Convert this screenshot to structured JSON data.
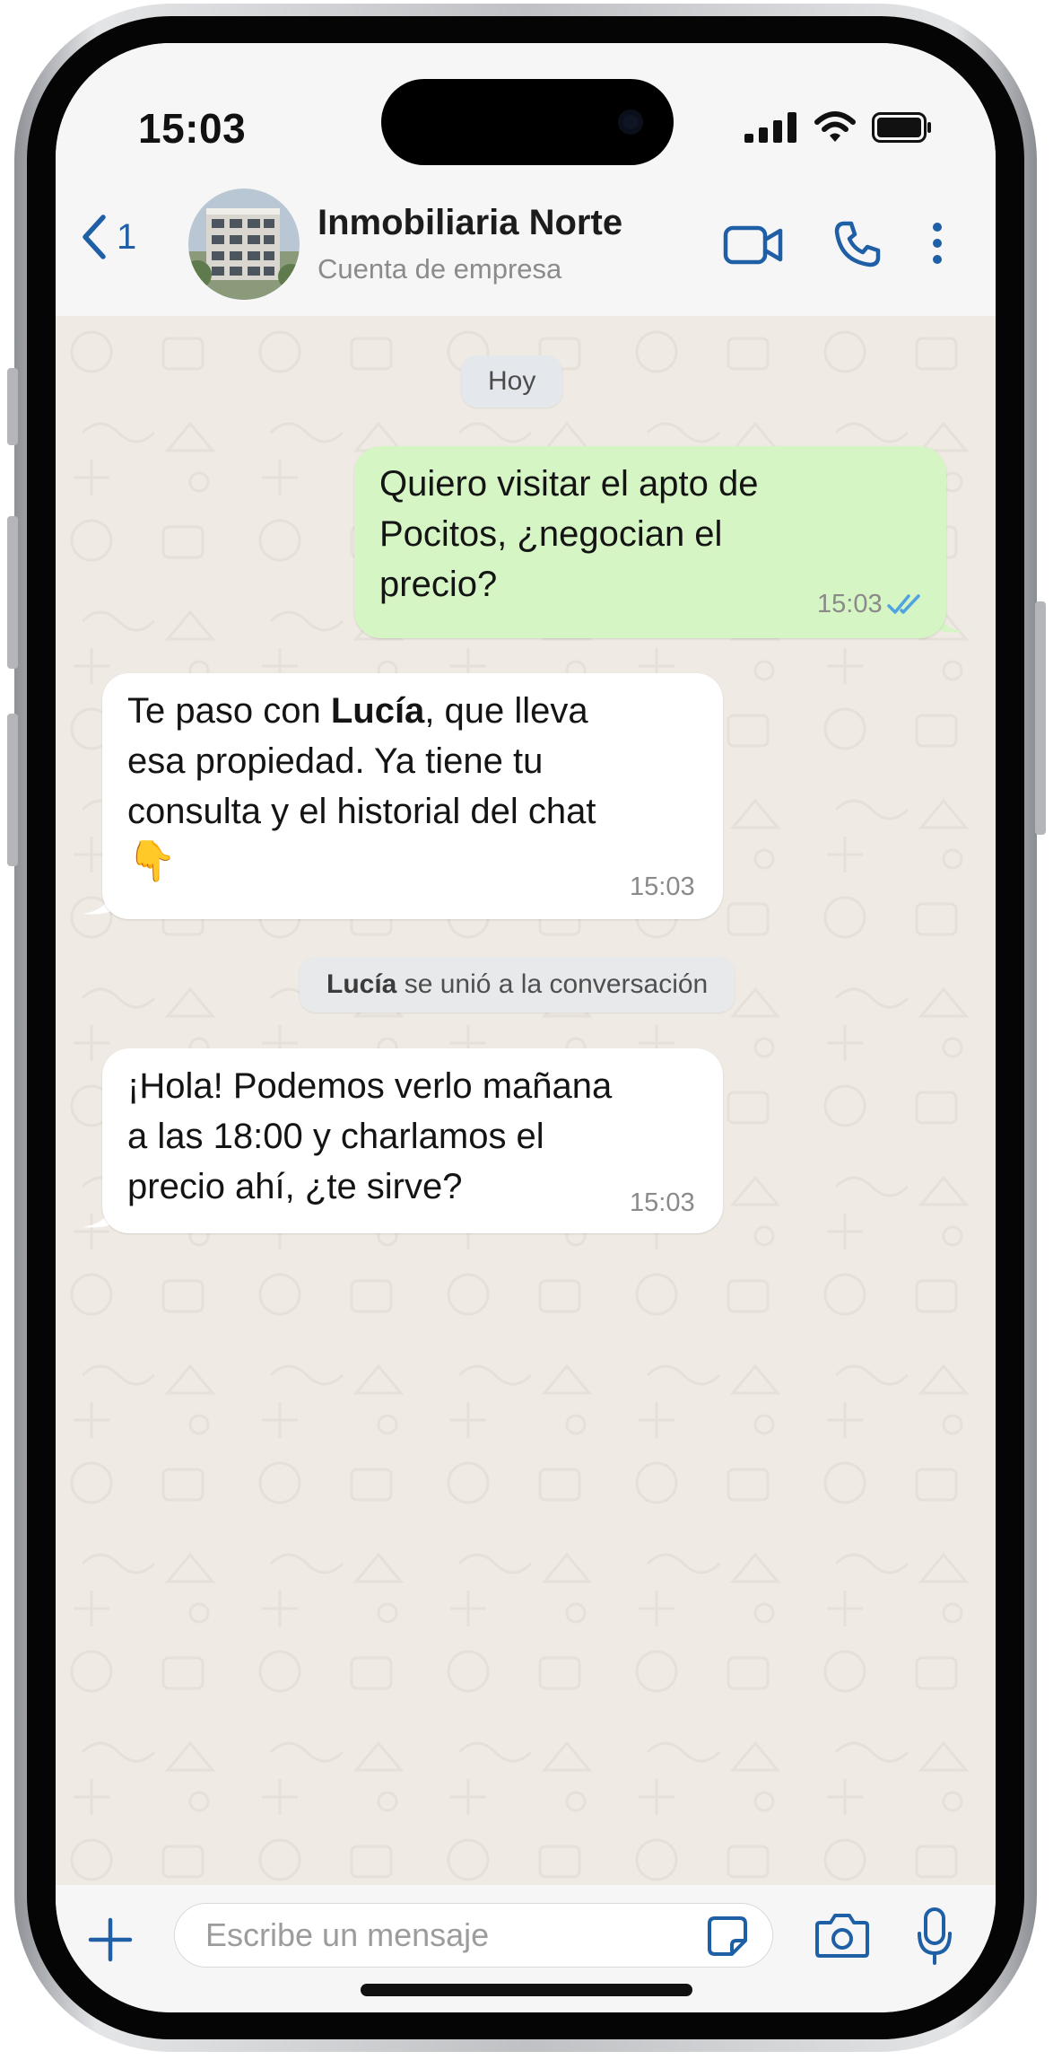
{
  "status_bar": {
    "time": "15:03"
  },
  "header": {
    "back_count": "1",
    "contact_name": "Inmobiliaria Norte",
    "contact_subtitle": "Cuenta de empresa"
  },
  "chat": {
    "day_label": "Hoy",
    "messages": [
      {
        "direction": "outgoing",
        "lines": [
          "Quiero visitar el apto de",
          "Pocitos, ¿negocian el",
          "precio?"
        ],
        "time": "15:03",
        "status": "read-double-check-icon"
      },
      {
        "direction": "incoming",
        "line1_prefix": "Te paso con ",
        "line1_bold": "Lucía",
        "line1_suffix": ", que lleva",
        "lines": [
          "esa propiedad. Ya tiene tu",
          "consulta y el historial del chat"
        ],
        "emoji": "👇",
        "time": "15:03"
      },
      {
        "direction": "incoming",
        "lines": [
          "¡Hola! Podemos verlo mañana",
          "a las 18:00 y charlamos el",
          "precio ahí, ¿te sirve?"
        ],
        "time": "15:03"
      }
    ],
    "system_notice": {
      "bold": "Lucía",
      "text": " se unió a la conversación"
    }
  },
  "input_bar": {
    "placeholder": "Escribe un mensaje"
  },
  "colors": {
    "accent": "#1f5fa6",
    "outgoing_bubble": "#d6f5c4",
    "incoming_bubble": "#ffffff",
    "chat_background": "#efebe4",
    "read_ticks": "#4fa3e0"
  },
  "icons": [
    "back-chevron-icon",
    "video-call-icon",
    "phone-icon",
    "more-options-icon",
    "plus-icon",
    "sticker-icon",
    "camera-icon",
    "microphone-icon",
    "signal-icon",
    "wifi-icon",
    "battery-icon"
  ]
}
